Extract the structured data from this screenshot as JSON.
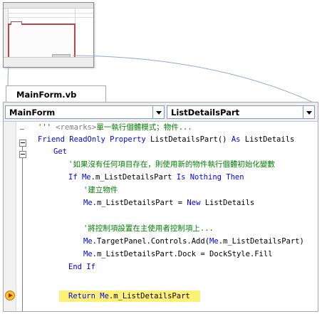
{
  "file_tab": {
    "label": "MainForm.vb"
  },
  "navbar": {
    "class_combo": "MainForm",
    "member_combo": "ListDetailsPart"
  },
  "code_lines": {
    "l1": {
      "a": "''' ",
      "b": "<remarks>",
      "c": "單一執行個體模式；物件..."
    },
    "l2": {
      "a": "Friend ReadOnly Property",
      "b": " ListDetailsPart() ",
      "c": "As",
      "d": " ListDetails"
    },
    "l3": {
      "a": "Get"
    },
    "l4": {
      "a": "'如果沒有任何項目存在，則使用新的物件執行個體初始化變數"
    },
    "l5": {
      "a": "If",
      "b": " ",
      "c": "Me",
      "d": ".m_ListDetailsPart ",
      "e": "Is Nothing Then"
    },
    "l6": {
      "a": "'建立物件"
    },
    "l7": {
      "a": "Me",
      "b": ".m_ListDetailsPart = ",
      "c": "New",
      "d": " ListDetails"
    },
    "l8": {
      "a": "'將控制項設置在主使用者控制項上..."
    },
    "l9": {
      "a": "Me",
      "b": ".TargetPanel.Controls.Add(",
      "c": "Me",
      "d": ".m_ListDetailsPart)"
    },
    "l10": {
      "a": "Me",
      "b": ".m_ListDetailsPart.Dock = DockStyle.Fill"
    },
    "l11": {
      "a": "End If"
    },
    "l12": {
      "a": "Return ",
      "b": "Me",
      "c": ".m_ListDetailsPart"
    }
  },
  "colors": {
    "keyword": "#0000ff",
    "comment": "#008000",
    "xml_tag": "#808080",
    "current_statement": "#fff176",
    "thumbnail_focus": "#b9464a",
    "callout_line": "#8fa9d6"
  },
  "icons": {
    "execution_pointer": "current-statement-arrow-icon",
    "dropdown": "chevron-down-icon",
    "collapse": "collapse-minus-icon"
  }
}
